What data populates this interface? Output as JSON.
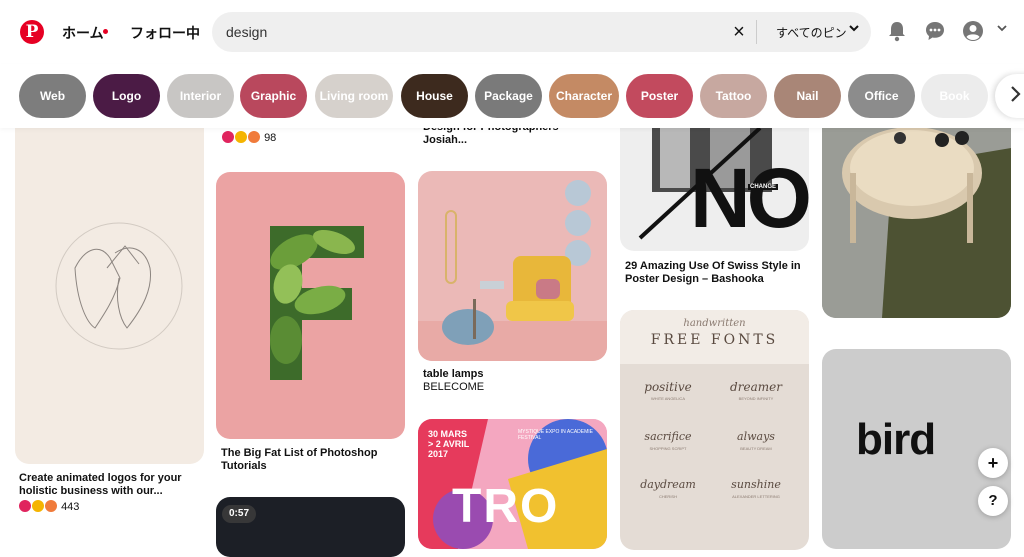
{
  "header": {
    "logo": "P",
    "nav_home": "ホーム",
    "nav_following": "フォロー中",
    "search_value": "design",
    "search_scope": "すべてのピン",
    "clear_icon": "×",
    "chevron": "⌄"
  },
  "chips": [
    {
      "label": "Web",
      "color": "#7d7d7d"
    },
    {
      "label": "Logo",
      "color": "#4b1b45"
    },
    {
      "label": "Interior",
      "color": "#c8c6c4"
    },
    {
      "label": "Graphic",
      "color": "#b9485d"
    },
    {
      "label": "Living room",
      "color": "#d6d1cc"
    },
    {
      "label": "House",
      "color": "#3d2a1e"
    },
    {
      "label": "Package",
      "color": "#7a7a7a"
    },
    {
      "label": "Character",
      "color": "#c48a64"
    },
    {
      "label": "Poster",
      "color": "#c24a5e"
    },
    {
      "label": "Tattoo",
      "color": "#c7a8a0"
    },
    {
      "label": "Nail",
      "color": "#a98677"
    },
    {
      "label": "Office",
      "color": "#8c8c8c"
    },
    {
      "label": "Book",
      "color": "#ececec"
    }
  ],
  "pins": {
    "p1": {
      "title_line1": "Create animated logos for your",
      "title_line2": "holistic business with our...",
      "count": "443"
    },
    "p2top": {
      "count": "98"
    },
    "p2": {
      "title_line1": "The Big Fat List of Photoshop",
      "title_line2": "Tutorials",
      "badge": "0:57",
      "letter": "F"
    },
    "p3top": {
      "title_line1": "Design for Photographers",
      "title_line2": "Josiah..."
    },
    "p3": {
      "title": "table lamps",
      "subtitle": "BELECOME"
    },
    "p3b": {
      "line1": "30 MARS",
      "line2": "> 2 AVRIL",
      "line3": "2017",
      "side": "MYSTIQUE EXPO IN ACADEMIE FESTIVAL",
      "big": "TRO"
    },
    "p4": {
      "title_line1": "29 Amazing Use Of Swiss Style in",
      "title_line2": "Poster Design – Bashooka",
      "big": "NO",
      "tag": "CHANGE"
    },
    "p4b": {
      "script": "handwritten",
      "heading": "FREE FONTS",
      "fonts": [
        "positive",
        "dreamer",
        "sacrifice",
        "always",
        "daydream",
        "sunshine"
      ],
      "notes": [
        "WHITE ANGELICA",
        "BEYOND INFINITY",
        "SHOPPING SCRIPT",
        "BEAUTY DREAM",
        "CHERISH",
        "ALEXANDER LETTERING"
      ]
    },
    "p5b": {
      "word": "bird"
    }
  },
  "fabs": {
    "add": "+",
    "help": "?"
  }
}
